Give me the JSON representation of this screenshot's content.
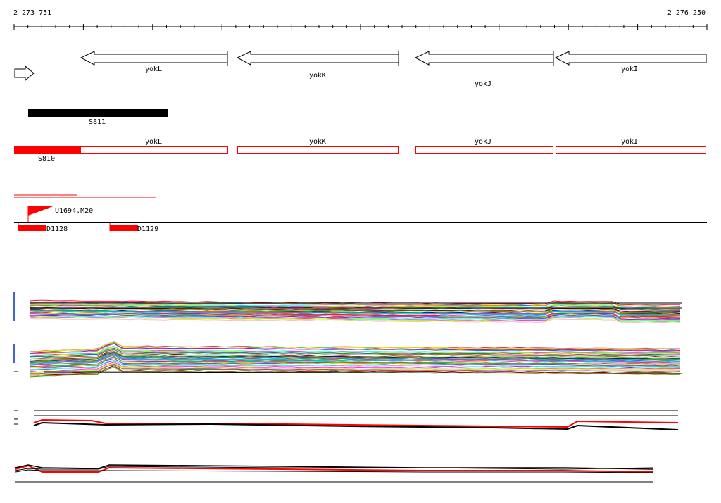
{
  "ruler": {
    "start_label": "2 273 751",
    "end_label": "2 276 250"
  },
  "genes": [
    {
      "name": "yokL"
    },
    {
      "name": "yokK"
    },
    {
      "name": "yokJ"
    },
    {
      "name": "yokI"
    }
  ],
  "segments": [
    {
      "name": "S811"
    },
    {
      "name": "S810"
    }
  ],
  "annotations": [
    {
      "name": "U1694.M20"
    },
    {
      "name": "D1128"
    },
    {
      "name": "D1129"
    }
  ],
  "colors": {
    "feature_red": "#ff0000",
    "segment_black": "#000000",
    "axis": "#000000"
  },
  "icons": [
    "forward-arrow-icon",
    "gene-arrow-icon",
    "flag-icon"
  ]
}
